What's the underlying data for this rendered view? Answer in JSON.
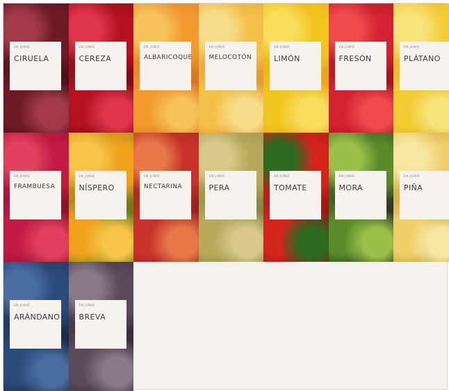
{
  "tiles": [
    {
      "tag": "EN JUNIO",
      "name": "CIRUELA",
      "icon": "plum-photo",
      "colors": [
        "#6e1a26",
        "#3d0c14",
        "#a23a4a"
      ]
    },
    {
      "tag": "EN JUNIO",
      "name": "CEREZA",
      "icon": "cherry-photo",
      "colors": [
        "#b3121e",
        "#6a0710",
        "#e0344a"
      ]
    },
    {
      "tag": "EN JUNIO",
      "name": "ALBARICOQUE",
      "icon": "apricot-photo",
      "colors": [
        "#f29a2e",
        "#d8641a",
        "#f7c25a"
      ]
    },
    {
      "tag": "EN JUNIO",
      "name": "MELOCOTÓN",
      "icon": "peach-photo",
      "colors": [
        "#f4c04a",
        "#e08a2a",
        "#f7dd8a"
      ]
    },
    {
      "tag": "EN JUNIO",
      "name": "LIMÓN",
      "icon": "lemon-photo",
      "colors": [
        "#f2c51e",
        "#e49a14",
        "#f8de5c"
      ]
    },
    {
      "tag": "EN JUNIO",
      "name": "FRESÓN",
      "icon": "strawberry-photo",
      "colors": [
        "#d42232",
        "#8e0f1a",
        "#f04a4e"
      ]
    },
    {
      "tag": "EN JUNIO",
      "name": "PLÁTANO",
      "icon": "banana-photo",
      "colors": [
        "#f3cc34",
        "#d9a818",
        "#f8e37a"
      ]
    },
    {
      "tag": "EN JUNIO",
      "name": "FRAMBUESA",
      "icon": "raspberry-photo",
      "colors": [
        "#c21a44",
        "#7a0c26",
        "#e2405e"
      ]
    },
    {
      "tag": "EN JUNIO",
      "name": "NÍSPERO",
      "icon": "loquat-photo",
      "colors": [
        "#f0a21c",
        "#3e6a1a",
        "#f6c54a"
      ]
    },
    {
      "tag": "EN JUNIO",
      "name": "NECTARINA",
      "icon": "nectarine-photo",
      "colors": [
        "#c8322a",
        "#8a1a16",
        "#e8774a"
      ]
    },
    {
      "tag": "EN JUNIO",
      "name": "PERA",
      "icon": "pear-photo",
      "colors": [
        "#b8a85a",
        "#6e7a3a",
        "#d8c98a"
      ]
    },
    {
      "tag": "EN JUNIO",
      "name": "TOMATE",
      "icon": "tomato-photo",
      "colors": [
        "#d4231c",
        "#8a1410",
        "#2e6a22"
      ]
    },
    {
      "tag": "EN JUNIO",
      "name": "MORA",
      "icon": "blackberry-photo",
      "colors": [
        "#5a8a2a",
        "#1c1a22",
        "#9ac04a"
      ]
    },
    {
      "tag": "EN JUNIO",
      "name": "PIÑA",
      "icon": "pineapple-photo",
      "colors": [
        "#f0cf6a",
        "#a87a22",
        "#f7e6a2"
      ]
    },
    {
      "tag": "EN JUNIO",
      "name": "ARÁNDANO",
      "icon": "blueberry-photo",
      "colors": [
        "#2a4a7a",
        "#142238",
        "#4a6ea2"
      ]
    },
    {
      "tag": "EN JUNIO",
      "name": "BREVA",
      "icon": "fig-photo",
      "colors": [
        "#5a4a5a",
        "#2a2230",
        "#8a7a88"
      ]
    }
  ]
}
